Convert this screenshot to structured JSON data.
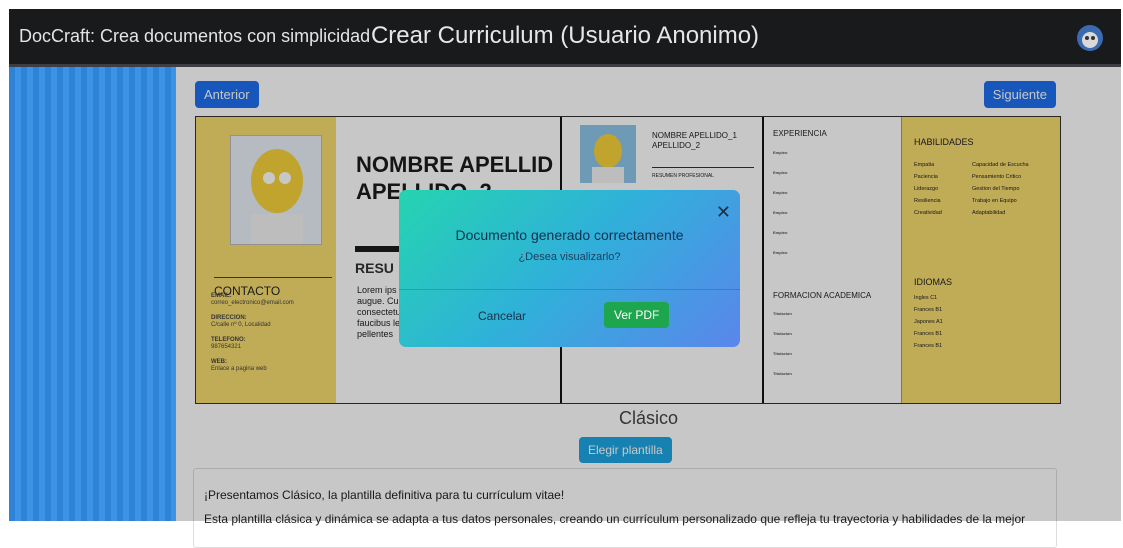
{
  "header": {
    "brand": "DocCraft: Crea documentos con simplicidad",
    "title": "Crear Curriculum (Usuario Anonimo)"
  },
  "nav": {
    "prev": "Anterior",
    "next": "Siguiente"
  },
  "preview1": {
    "name1": "NOMBRE APELLID",
    "name2": "APELLIDO_2",
    "resumen": "RESU",
    "body": "Lorem ips lectus est sollicitudi condimen Vivamus augue. Curabitur eu rutrum sapien, et rutrum arcu consectetur eros non interdum commodo. Sed sit faucibus lectus ac, iaculis dolor. Vivamus placera pellentes",
    "contact_title": "CONTACTO",
    "email_label": "EMAIL:",
    "email": "correo_electronico@email.com",
    "dir_label": "DIRECCION:",
    "dir": "C/calle nº 0, Localidad",
    "tel_label": "TELEFONO:",
    "tel": "987654321",
    "web_label": "WEB:",
    "web": "Enlace a pagina web"
  },
  "preview2": {
    "name": "NOMBRE APELLIDO_1 APELLIDO_2",
    "resumen": "RESUMEN PROFESIONAL"
  },
  "preview3": {
    "experiencia": "EXPERIENCIA",
    "empleo": "Empleo",
    "formacion": "FORMACION ACADEMICA",
    "titulacion": "Titulacion"
  },
  "preview4": {
    "habilidades": "HABILIDADES",
    "skills": [
      "Empatia",
      "Capacidad de Escucha",
      "Paciencia",
      "Pensamiento Critico",
      "Liderazgo",
      "Gestion del Tiempo",
      "Resiliencia",
      "Trabajo en Equipo",
      "Creatividad",
      "Adaptabilidad"
    ],
    "idiomas": "IDIOMAS",
    "langs": [
      "Ingles C1",
      "Frances B1",
      "Japones A1",
      "Frances B1",
      "Frances B1"
    ]
  },
  "modal": {
    "title": "Documento generado correctamente",
    "subtitle": "¿Desea visualizarlo?",
    "cancel": "Cancelar",
    "confirm": "Ver PDF"
  },
  "template": {
    "name": "Clásico",
    "choose": "Elegir plantilla",
    "desc1": "¡Presentamos Clásico, la plantilla definitiva para tu currículum vitae!",
    "desc2": "Esta plantilla clásica y dinámica se adapta a tus datos personales, creando un currículum personalizado que refleja tu trayectoria y habilidades de la mejor"
  }
}
